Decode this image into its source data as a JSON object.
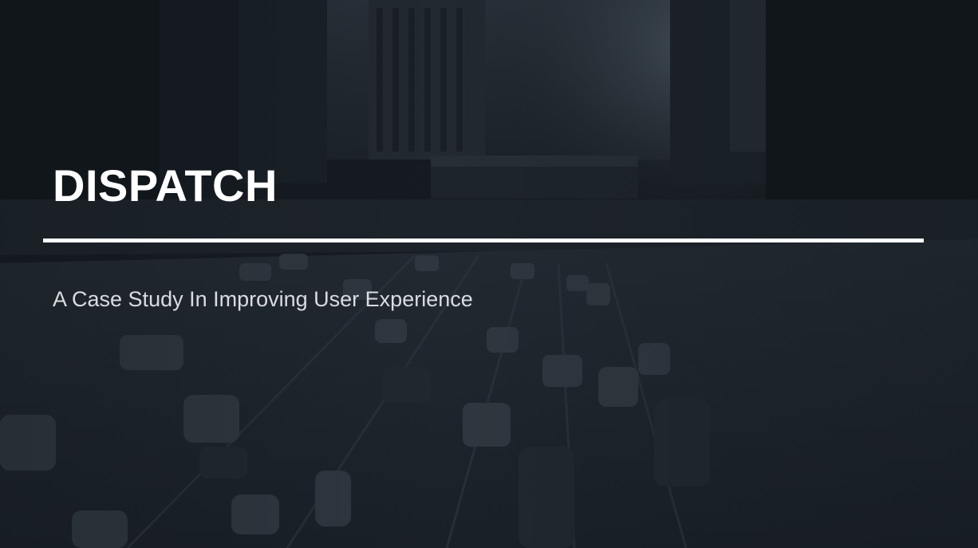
{
  "hero": {
    "title": "DISPATCH",
    "subtitle": "A Case Study In Improving User Experience"
  },
  "colors": {
    "background": "#161c22",
    "title": "#ffffff",
    "subtitle": "#d9dde1",
    "rule": "#ffffff"
  },
  "background_image": {
    "description_icon": "city-freeway-photo"
  }
}
